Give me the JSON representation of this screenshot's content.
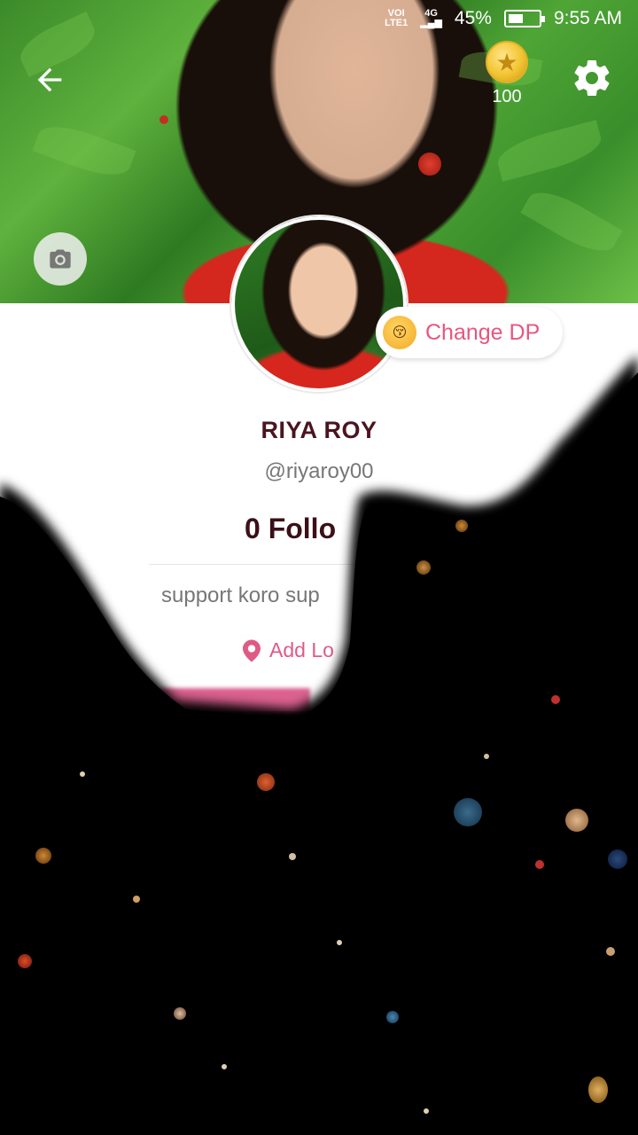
{
  "status_bar": {
    "network_top": "VOI",
    "network_bottom": "LTE1",
    "signal_label": "4G",
    "battery_percent": "45%",
    "time": "9:55 AM"
  },
  "header": {
    "back_icon": "arrow-left-icon",
    "coins": "100",
    "settings_icon": "gear-icon",
    "camera_icon": "camera-icon"
  },
  "profile": {
    "change_dp_label": "Change DP",
    "change_dp_emoji": "😚",
    "name": "RIYA ROY",
    "handle": "@riyaroy00",
    "followers": "0 Follo",
    "bio": "support koro sup",
    "location_label": "Add Lo",
    "location_icon": "map-pin-icon"
  },
  "colors": {
    "accent": "#e8567f",
    "name_color": "#4a1420",
    "overlay_black": "#000000"
  }
}
